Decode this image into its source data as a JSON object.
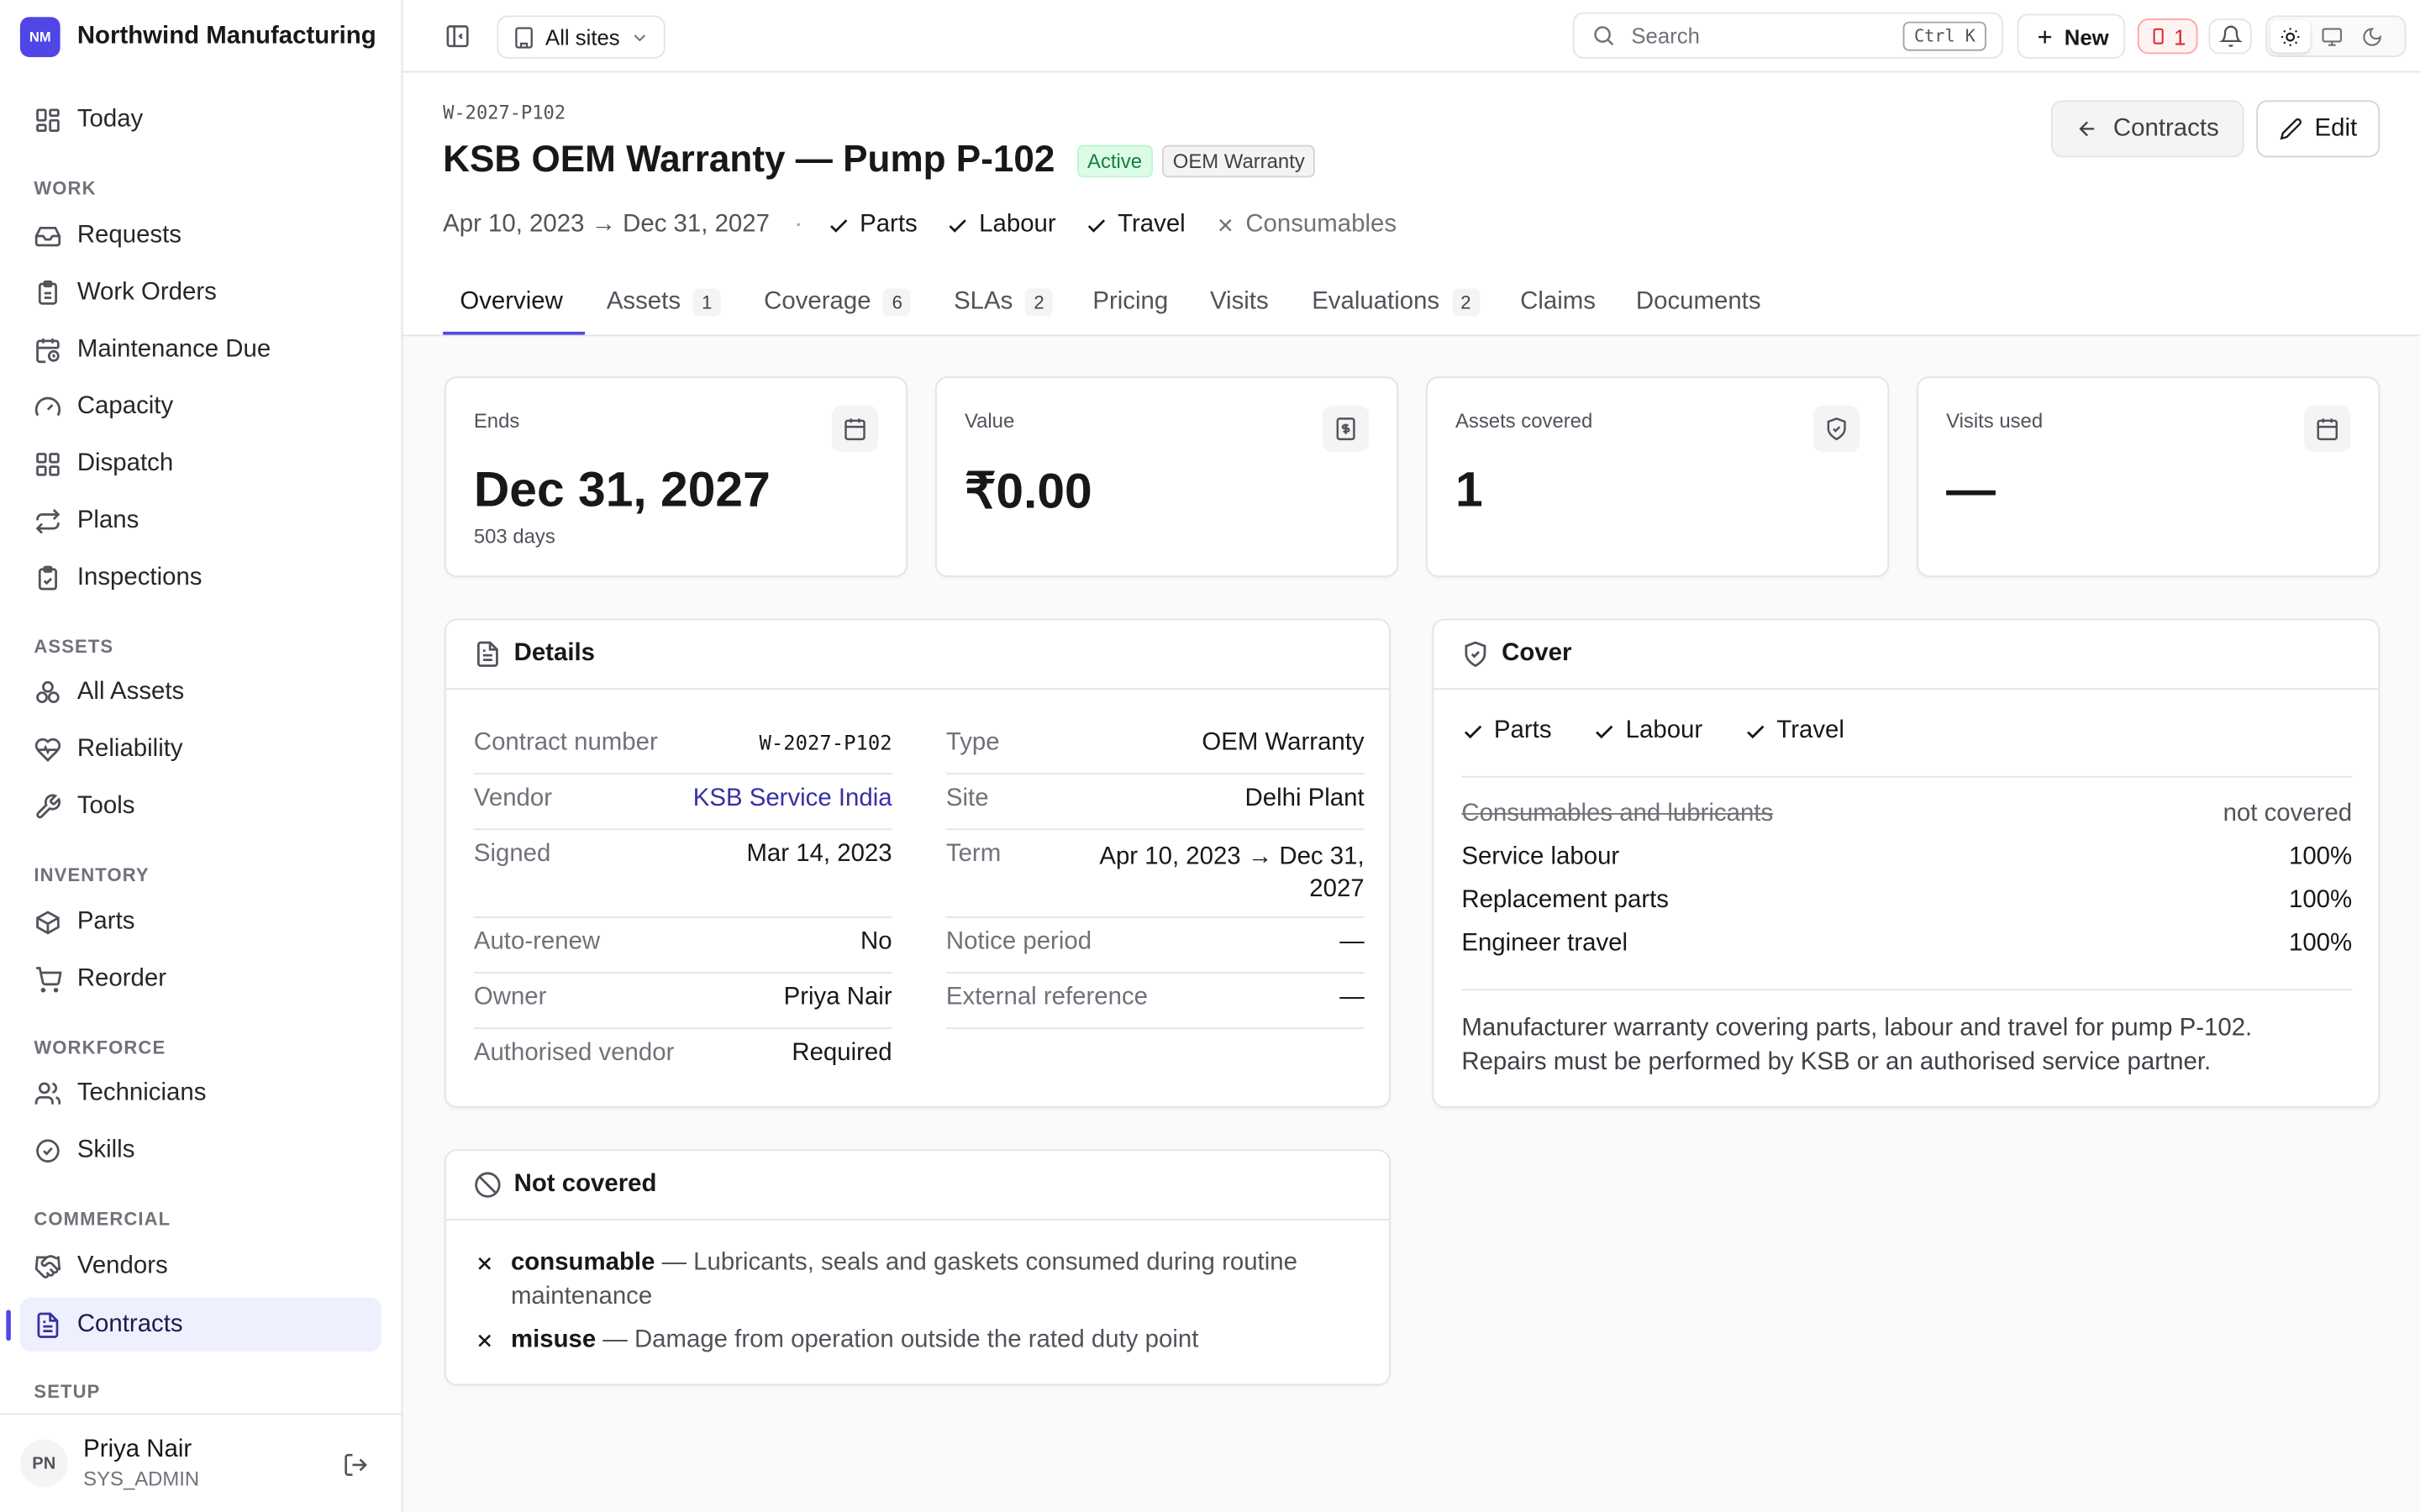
{
  "app": {
    "initials": "NM",
    "name": "Northwind Manufacturing"
  },
  "sidebar": {
    "today": "Today",
    "sections": {
      "work": "WORK",
      "assets": "ASSETS",
      "inventory": "INVENTORY",
      "workforce": "WORKFORCE",
      "commercial": "COMMERCIAL",
      "setup": "SETUP"
    },
    "items": {
      "requests": "Requests",
      "work_orders": "Work Orders",
      "maintenance_due": "Maintenance Due",
      "capacity": "Capacity",
      "dispatch": "Dispatch",
      "plans": "Plans",
      "inspections": "Inspections",
      "all_assets": "All Assets",
      "reliability": "Reliability",
      "tools": "Tools",
      "parts": "Parts",
      "reorder": "Reorder",
      "technicians": "Technicians",
      "skills": "Skills",
      "vendors": "Vendors",
      "contracts": "Contracts"
    },
    "user": {
      "initials": "PN",
      "name": "Priya Nair",
      "role": "SYS_ADMIN"
    }
  },
  "topbar": {
    "site_select": "All sites",
    "search_placeholder": "Search",
    "shortcut": "Ctrl K",
    "new_label": "New",
    "alert_count": "1"
  },
  "contract": {
    "id": "W-2027-P102",
    "title": "KSB OEM Warranty — Pump P-102",
    "status": "Active",
    "kind": "OEM Warranty",
    "period": "Apr 10, 2023 → Dec 31, 2027",
    "coverage": {
      "parts": "Parts",
      "labour": "Labour",
      "travel": "Travel",
      "consumables": "Consumables"
    },
    "back_label": "Contracts",
    "edit_label": "Edit"
  },
  "tabs": [
    {
      "label": "Overview",
      "count": ""
    },
    {
      "label": "Assets",
      "count": "1"
    },
    {
      "label": "Coverage",
      "count": "6"
    },
    {
      "label": "SLAs",
      "count": "2"
    },
    {
      "label": "Pricing",
      "count": ""
    },
    {
      "label": "Visits",
      "count": ""
    },
    {
      "label": "Evaluations",
      "count": "2"
    },
    {
      "label": "Claims",
      "count": ""
    },
    {
      "label": "Documents",
      "count": ""
    }
  ],
  "stats": [
    {
      "label": "Ends",
      "value": "Dec 31, 2027",
      "sub": "503 days",
      "icon": "calendar-icon"
    },
    {
      "label": "Value",
      "value": "₹0.00",
      "sub": "",
      "icon": "receipt-icon"
    },
    {
      "label": "Assets covered",
      "value": "1",
      "sub": "",
      "icon": "shield-icon"
    },
    {
      "label": "Visits used",
      "value": "—",
      "sub": "",
      "icon": "calendar-icon"
    }
  ],
  "details": {
    "title": "Details",
    "left": [
      {
        "k": "Contract number",
        "v": "W-2027-P102"
      },
      {
        "k": "Vendor",
        "v": "KSB Service India"
      },
      {
        "k": "Signed",
        "v": "Mar 14, 2023"
      },
      {
        "k": "Auto-renew",
        "v": "No"
      },
      {
        "k": "Owner",
        "v": "Priya Nair"
      },
      {
        "k": "Authorised vendor",
        "v": "Required"
      }
    ],
    "right": [
      {
        "k": "Type",
        "v": "OEM Warranty"
      },
      {
        "k": "Site",
        "v": "Delhi Plant"
      },
      {
        "k": "Term",
        "v": "Apr 10, 2023 → Dec 31, 2027"
      },
      {
        "k": "Notice period",
        "v": "—"
      },
      {
        "k": "External reference",
        "v": "—"
      }
    ]
  },
  "cover": {
    "title": "Cover",
    "checks": [
      "Parts",
      "Labour",
      "Travel"
    ],
    "lines": [
      {
        "k": "Consumables and lubricants",
        "v": "not covered"
      },
      {
        "k": "Service labour",
        "v": "100%"
      },
      {
        "k": "Replacement parts",
        "v": "100%"
      },
      {
        "k": "Engineer travel",
        "v": "100%"
      }
    ],
    "note": "Manufacturer warranty covering parts, labour and travel for pump P-102. Repairs must be performed by KSB or an authorised service partner."
  },
  "not_covered": {
    "title": "Not covered",
    "items": [
      {
        "term": "consumable",
        "desc": " — Lubricants, seals and gaskets consumed during routine maintenance"
      },
      {
        "term": "misuse",
        "desc": " — Damage from operation outside the rated duty point"
      }
    ]
  },
  "colors": {
    "accent": "#4f46e5",
    "active_badge_bg": "#dcfce7",
    "active_badge_text": "#15803d",
    "link": "#3730a3",
    "alert": "#dc2626"
  }
}
